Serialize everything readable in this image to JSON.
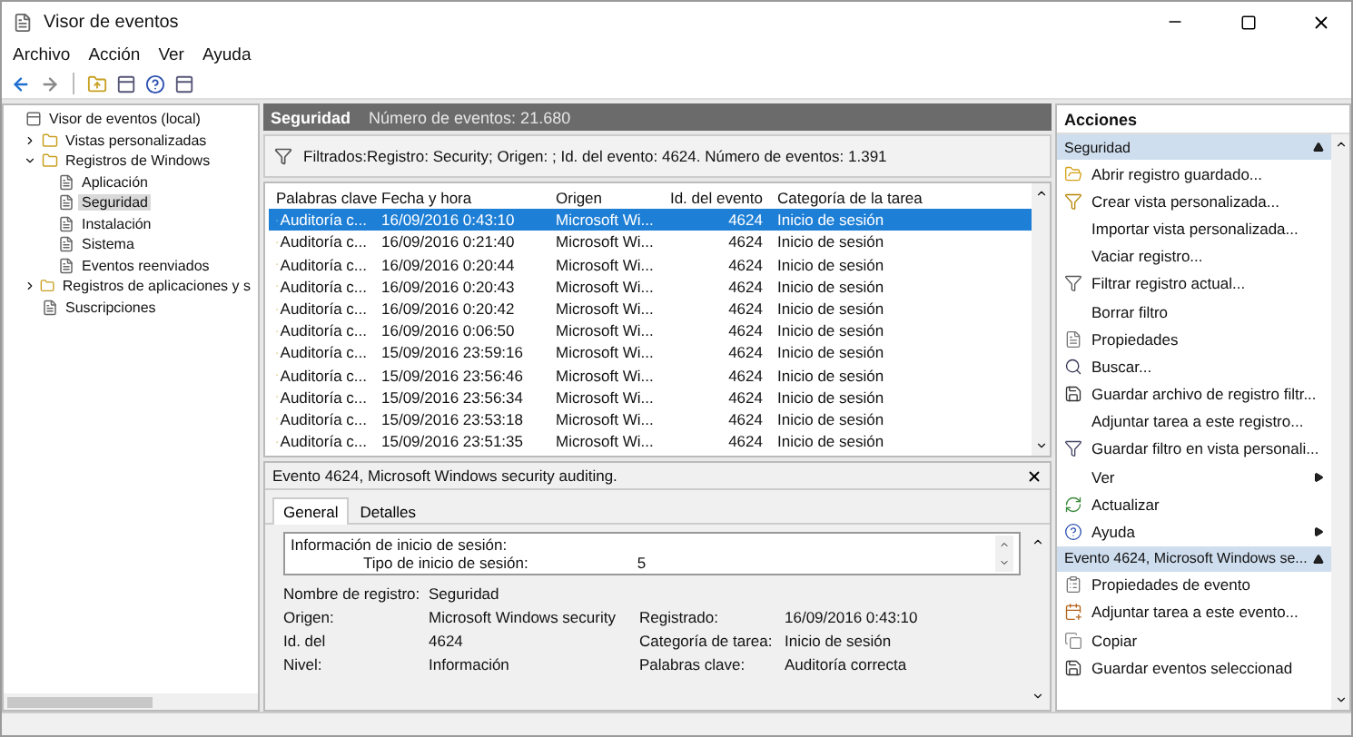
{
  "window": {
    "title": "Visor de eventos"
  },
  "menu": [
    "Archivo",
    "Acción",
    "Ver",
    "Ayuda"
  ],
  "tree": [
    {
      "label": "Visor de eventos (local)",
      "selected": false,
      "children": [
        {
          "label": "Vistas personalizadas",
          "selected": false,
          "expanded": false
        },
        {
          "label": "Registros de Windows",
          "selected": false,
          "expanded": true,
          "children": [
            {
              "label": "Aplicación",
              "selected": false
            },
            {
              "label": "Seguridad",
              "selected": true
            },
            {
              "label": "Instalación",
              "selected": false
            },
            {
              "label": "Sistema",
              "selected": false
            },
            {
              "label": "Eventos reenviados",
              "selected": false
            }
          ]
        },
        {
          "label": "Registros de aplicaciones y s",
          "selected": false,
          "expanded": false
        },
        {
          "label": "Suscripciones",
          "selected": false
        }
      ]
    }
  ],
  "log_header": {
    "name": "Seguridad",
    "count": "Número de eventos: 21.680"
  },
  "filter": "Filtrados:Registro: Security; Origen: ; Id. del evento: 4624. Número de eventos: 1.391",
  "table": {
    "columns": [
      "Palabras clave",
      "Fecha y hora",
      "Origen",
      "Id. del evento",
      "Categoría de la tarea"
    ],
    "rows": [
      {
        "selected": true,
        "cells": [
          "Auditoría c...",
          "16/09/2016 0:43:10",
          "Microsoft Wi...",
          "4624",
          "Inicio de sesión"
        ]
      },
      {
        "selected": false,
        "cells": [
          "Auditoría c...",
          "16/09/2016 0:21:40",
          "Microsoft Wi...",
          "4624",
          "Inicio de sesión"
        ]
      },
      {
        "selected": false,
        "cells": [
          "Auditoría c...",
          "16/09/2016 0:20:44",
          "Microsoft Wi...",
          "4624",
          "Inicio de sesión"
        ]
      },
      {
        "selected": false,
        "cells": [
          "Auditoría c...",
          "16/09/2016 0:20:43",
          "Microsoft Wi...",
          "4624",
          "Inicio de sesión"
        ]
      },
      {
        "selected": false,
        "cells": [
          "Auditoría c...",
          "16/09/2016 0:20:42",
          "Microsoft Wi...",
          "4624",
          "Inicio de sesión"
        ]
      },
      {
        "selected": false,
        "cells": [
          "Auditoría c...",
          "16/09/2016 0:06:50",
          "Microsoft Wi...",
          "4624",
          "Inicio de sesión"
        ]
      },
      {
        "selected": false,
        "cells": [
          "Auditoría c...",
          "15/09/2016 23:59:16",
          "Microsoft Wi...",
          "4624",
          "Inicio de sesión"
        ]
      },
      {
        "selected": false,
        "cells": [
          "Auditoría c...",
          "15/09/2016 23:56:46",
          "Microsoft Wi...",
          "4624",
          "Inicio de sesión"
        ]
      },
      {
        "selected": false,
        "cells": [
          "Auditoría c...",
          "15/09/2016 23:56:34",
          "Microsoft Wi...",
          "4624",
          "Inicio de sesión"
        ]
      },
      {
        "selected": false,
        "cells": [
          "Auditoría c...",
          "15/09/2016 23:53:18",
          "Microsoft Wi...",
          "4624",
          "Inicio de sesión"
        ]
      },
      {
        "selected": false,
        "cells": [
          "Auditoría c...",
          "15/09/2016 23:51:35",
          "Microsoft Wi...",
          "4624",
          "Inicio de sesión"
        ]
      }
    ]
  },
  "detail": {
    "title": "Evento 4624, Microsoft Windows security auditing.",
    "tabs": [
      {
        "label": "General",
        "selected": true
      },
      {
        "label": "Detalles",
        "selected": false
      }
    ],
    "description": [
      "Información de inicio de sesión:",
      "Tipo de inicio de sesión:",
      "5"
    ],
    "fields": [
      {
        "label": "Nombre de registro:",
        "value": "Seguridad"
      },
      {
        "label": "Origen:",
        "value": "Microsoft Windows security",
        "label2": "Registrado:",
        "value2": "16/09/2016 0:43:10"
      },
      {
        "label": "Id. del",
        "value": "4624",
        "label2": "Categoría de tarea:",
        "value2": "Inicio de sesión"
      },
      {
        "label": "Nivel:",
        "value": "Información",
        "label2": "Palabras clave:",
        "value2": "Auditoría correcta"
      }
    ]
  },
  "actions": {
    "title": "Acciones",
    "sections": [
      {
        "title": "Seguridad",
        "expanded": true,
        "items": [
          {
            "label": "Abrir registro guardado...",
            "submenu": false
          },
          {
            "label": "Crear vista personalizada...",
            "submenu": false
          },
          {
            "label": "Importar vista personalizada...",
            "submenu": false
          },
          {
            "label": "Vaciar registro...",
            "submenu": false
          },
          {
            "label": "Filtrar registro actual...",
            "submenu": false
          },
          {
            "label": "Borrar filtro",
            "submenu": false
          },
          {
            "label": "Propiedades",
            "submenu": false
          },
          {
            "label": "Buscar...",
            "submenu": false
          },
          {
            "label": "Guardar archivo de registro filtr...",
            "submenu": false
          },
          {
            "label": "Adjuntar tarea a este registro...",
            "submenu": false
          },
          {
            "label": "Guardar filtro en vista personali...",
            "submenu": false
          },
          {
            "label": "Ver",
            "submenu": true
          },
          {
            "label": "Actualizar",
            "submenu": false
          },
          {
            "label": "Ayuda",
            "submenu": true
          }
        ]
      },
      {
        "title": "Evento 4624, Microsoft Windows se...",
        "expanded": true,
        "items": [
          {
            "label": "Propiedades de evento",
            "submenu": false
          },
          {
            "label": "Adjuntar tarea a este evento...",
            "submenu": false
          },
          {
            "label": "Copiar",
            "submenu": false
          },
          {
            "label": "Guardar eventos seleccionad",
            "submenu": false
          }
        ]
      }
    ]
  }
}
